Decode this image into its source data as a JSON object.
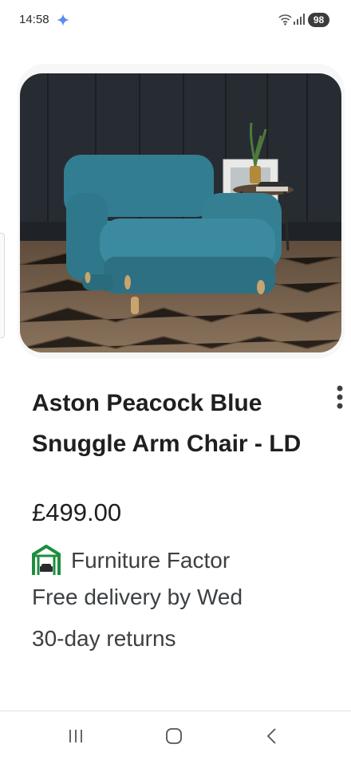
{
  "status_bar": {
    "time": "14:58",
    "battery": "98",
    "icons": [
      "sparkle-icon",
      "wifi-icon",
      "signal-icon"
    ]
  },
  "product": {
    "image": "teal velvet snuggle armchair in a dark panelled room",
    "title": "Aston Peacock Blue Snuggle Arm Chair - LD",
    "price": "£499.00",
    "seller": "Furniture Factor",
    "delivery": "Free delivery by Wed",
    "returns": "30-day returns"
  },
  "colors": {
    "accent_seller_logo": "#1e8e3e",
    "chair": "#2f7c8f",
    "wall": "#262b31"
  },
  "nav_bar": {
    "icons": [
      "recents-icon",
      "home-icon",
      "back-icon"
    ]
  }
}
